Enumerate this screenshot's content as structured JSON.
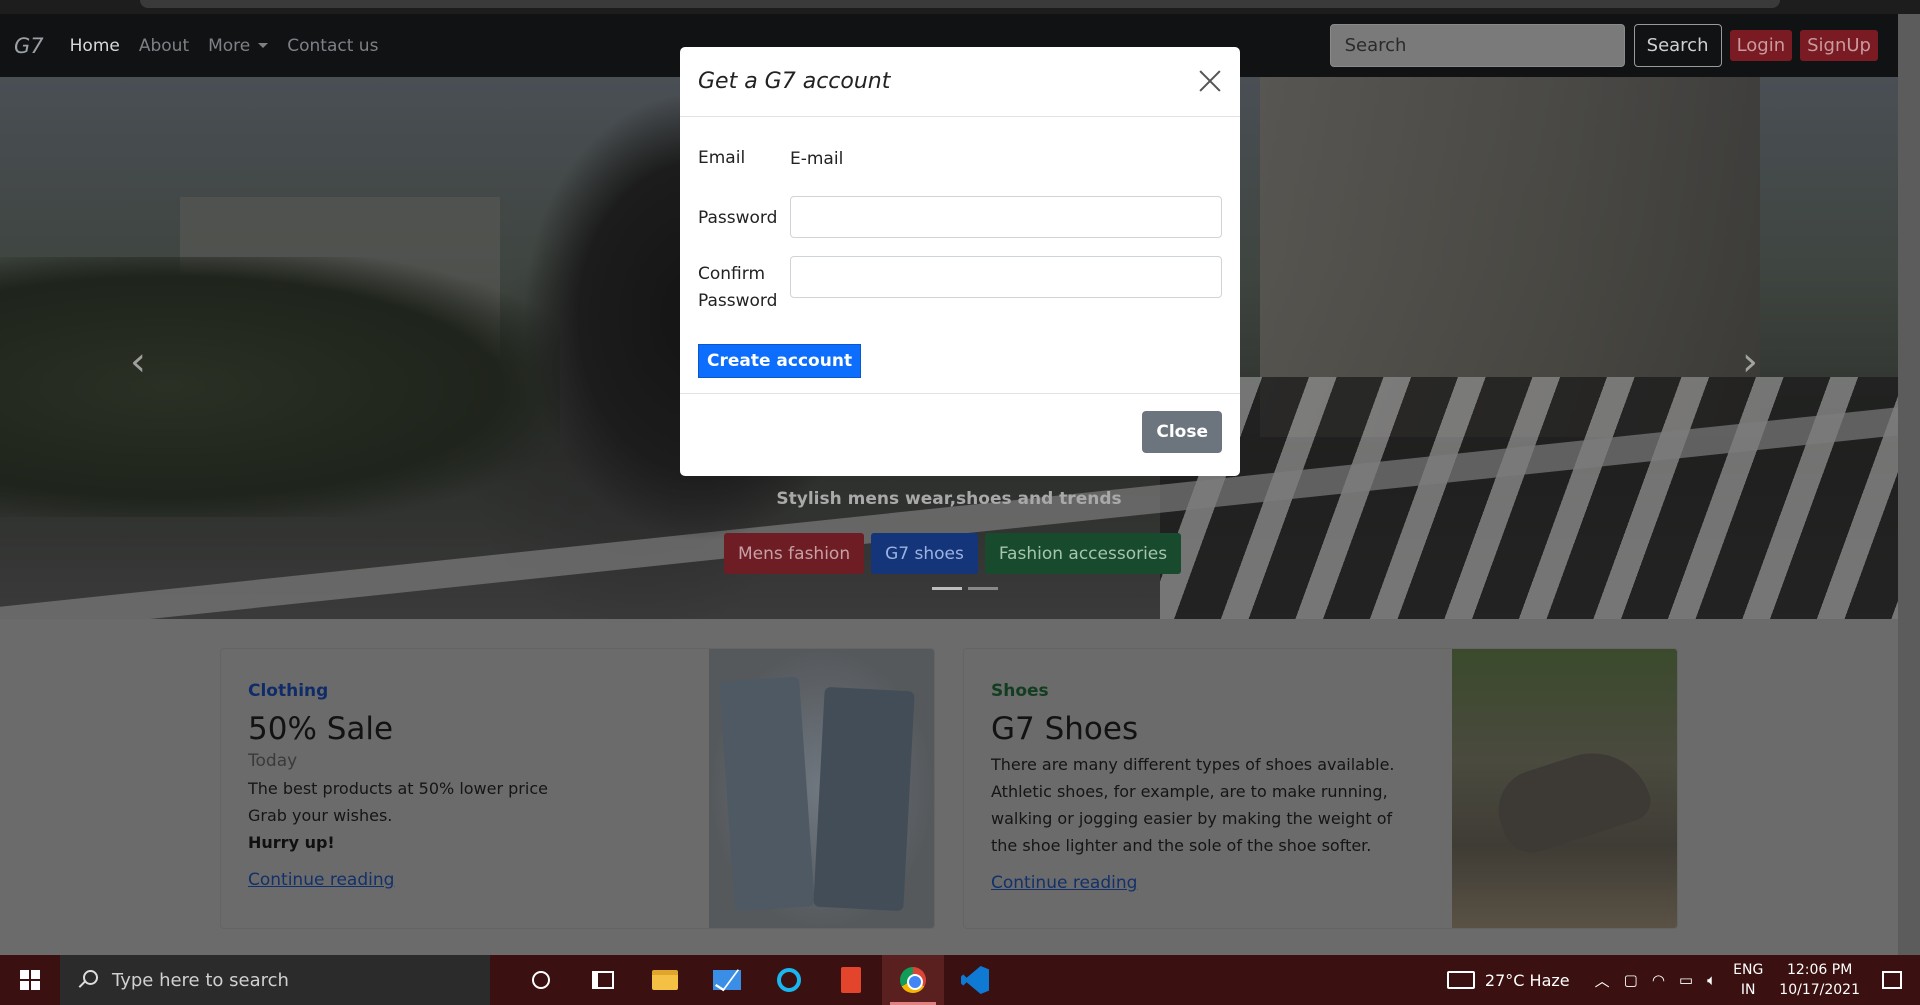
{
  "navbar": {
    "brand": "G7",
    "links": {
      "home": "Home",
      "about": "About",
      "more": "More",
      "contact": "Contact us"
    },
    "search_placeholder": "Search",
    "search_button": "Search",
    "login": "Login",
    "signup": "SignUp"
  },
  "hero": {
    "tagline": "Stylish mens wear,shoes and trends",
    "buttons": {
      "mens": "Mens fashion",
      "shoes": "G7 shoes",
      "accessories": "Fashion accessories"
    },
    "prev_arrow": "‹",
    "next_arrow": "›"
  },
  "modal": {
    "title": "Get a G7 account",
    "email_label": "Email",
    "email_value": "E-mail",
    "password_label": "Password",
    "confirm_label_1": "Confirm",
    "confirm_label_2": "Password",
    "create_button": "Create account",
    "close_button": "Close"
  },
  "cards": [
    {
      "category": "Clothing",
      "title": "50% Sale",
      "subtitle": "Today",
      "text_1": "The best products at 50% lower price",
      "text_2": "Grab your wishes.",
      "strong": "Hurry up!",
      "link": "Continue reading"
    },
    {
      "category": "Shoes",
      "title": "G7 Shoes",
      "text_1": "There are many different types of shoes available.",
      "text_2": "Athletic shoes, for example, are to make running,",
      "text_3": "walking or jogging easier by making the weight of",
      "text_4": "the shoe lighter and the sole of the shoe softer.",
      "link": "Continue reading"
    }
  ],
  "taskbar": {
    "search_placeholder": "Type here to search",
    "weather": "27°C  Haze",
    "lang_1": "ENG",
    "lang_2": "IN",
    "time": "12:06 PM",
    "date": "10/17/2021"
  },
  "colors": {
    "primary": "#0d6efd",
    "danger": "#dc3545",
    "success": "#198754",
    "secondary": "#6c757d"
  }
}
